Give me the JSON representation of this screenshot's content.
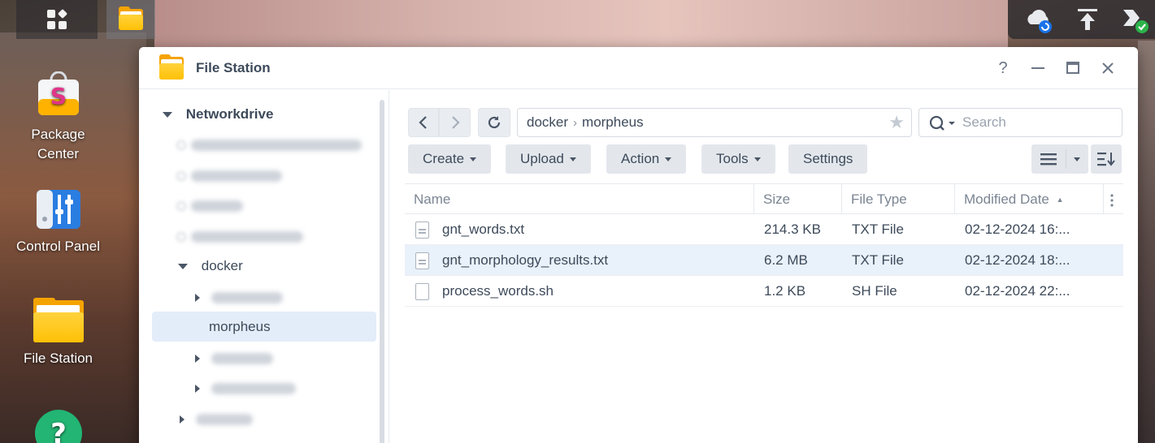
{
  "taskbar": {
    "apps_icon": "grid-icon",
    "active_app_icon": "folder-icon",
    "tray": [
      "cloud-sync-icon",
      "upload-icon",
      "security-check-icon"
    ]
  },
  "desktop": {
    "icons": [
      {
        "label_line1": "Package",
        "label_line2": "Center",
        "icon": "package-center-icon"
      },
      {
        "label": "Control Panel",
        "icon": "control-panel-icon"
      },
      {
        "label": "File Station",
        "icon": "folder-icon"
      },
      {
        "label": "",
        "icon": "help-icon"
      }
    ]
  },
  "window": {
    "title": "File Station",
    "controls": {
      "help": "?",
      "minimize": "—",
      "maximize": "□",
      "close": "✕"
    }
  },
  "tree": {
    "root": "Networkdrive",
    "docker": "docker",
    "selected": "morpheus"
  },
  "toolbar": {
    "path": [
      "docker",
      "morpheus"
    ],
    "search_placeholder": "Search",
    "buttons": [
      "Create",
      "Upload",
      "Action",
      "Tools",
      "Settings"
    ]
  },
  "table": {
    "columns": [
      "Name",
      "Size",
      "File Type",
      "Modified Date"
    ],
    "sort_indicator": "▲",
    "rows": [
      {
        "name": "gnt_words.txt",
        "size": "214.3 KB",
        "type": "TXT File",
        "modified": "02-12-2024 16:..."
      },
      {
        "name": "gnt_morphology_results.txt",
        "size": "6.2 MB",
        "type": "TXT File",
        "modified": "02-12-2024 18:..."
      },
      {
        "name": "process_words.sh",
        "size": "1.2 KB",
        "type": "SH File",
        "modified": "02-12-2024 22:..."
      }
    ],
    "selected_row": 1
  }
}
